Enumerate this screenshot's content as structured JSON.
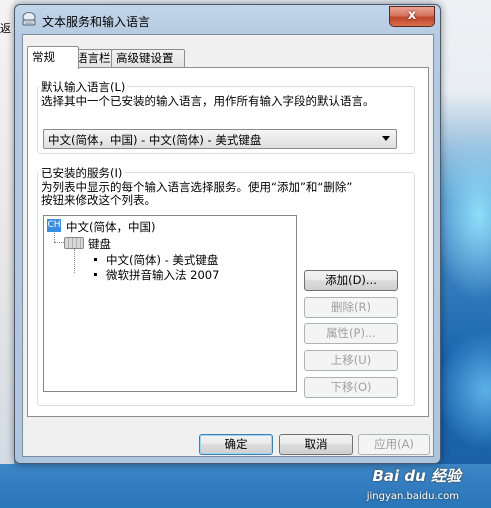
{
  "window": {
    "title": "文本服务和输入语言",
    "close_glyph": "x"
  },
  "desktop": {
    "left_cut_text": "返"
  },
  "tabs": [
    {
      "label": "常规",
      "active": true
    },
    {
      "label": "语言栏",
      "active": false
    },
    {
      "label": "高级键设置",
      "active": false
    }
  ],
  "default_lang": {
    "group_label": "默认输入语言(L)",
    "description": "选择其中一个已安装的输入语言，用作所有输入字段的默认语言。",
    "selected": "中文(简体，中国) - 中文(简体) - 美式键盘"
  },
  "installed": {
    "group_label": "已安装的服务(I)",
    "description_line1": "为列表中显示的每个输入语言选择服务。使用“添加”和“删除”",
    "description_line2": "按钮来修改这个列表。",
    "tree": {
      "language_badge": "CH",
      "language": "中文(简体，中国)",
      "category": "键盘",
      "items": [
        "中文(简体) - 美式键盘",
        "微软拼音输入法 2007"
      ]
    },
    "buttons": {
      "add": "添加(D)...",
      "remove": "删除(R)",
      "properties": "属性(P)...",
      "move_up": "上移(U)",
      "move_down": "下移(O)"
    }
  },
  "footer": {
    "ok": "确定",
    "cancel": "取消",
    "apply": "应用(A)"
  },
  "watermark": {
    "brand": "Bai du 经验",
    "url": "jingyan.baidu.com"
  }
}
